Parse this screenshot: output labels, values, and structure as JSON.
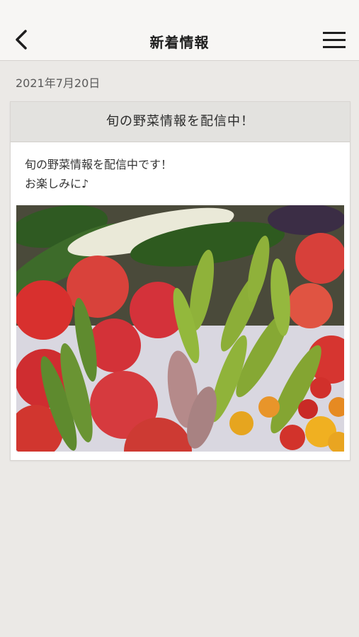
{
  "header": {
    "title": "新着情報",
    "back_icon": "chevron-left-icon",
    "menu_icon": "hamburger-menu-icon"
  },
  "post": {
    "date": "2021年7月20日",
    "title": "旬の野菜情報を配信中！",
    "body_line1": "旬の野菜情報を配信中です！",
    "body_line2": "お楽しみに♪",
    "image_subject": "vegetables-photo"
  },
  "colors": {
    "header_bg": "#f7f6f4",
    "page_bg": "#ebe9e6",
    "card_header_bg": "#e3e2df"
  }
}
